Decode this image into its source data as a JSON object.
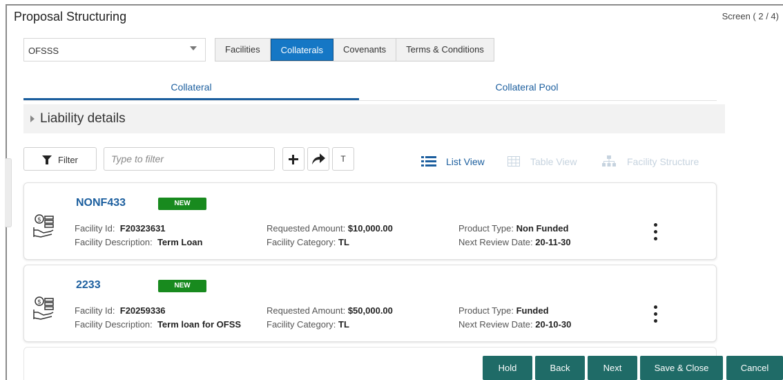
{
  "header": {
    "title": "Proposal Structuring",
    "screen_indicator": "Screen ( 2 / 4)"
  },
  "selector": {
    "value": "OFSSS"
  },
  "main_tabs": [
    {
      "label": "Facilities",
      "active": false
    },
    {
      "label": "Collaterals",
      "active": true
    },
    {
      "label": "Covenants",
      "active": false
    },
    {
      "label": "Terms & Conditions",
      "active": false
    }
  ],
  "sub_tabs": [
    {
      "label": "Collateral",
      "active": true
    },
    {
      "label": "Collateral Pool",
      "active": false
    }
  ],
  "section": {
    "liability_label": "Liability details"
  },
  "toolbar": {
    "filter_label": "Filter",
    "filter_placeholder": "Type to filter",
    "t_label": "T",
    "list_view": "List View",
    "table_view": "Table View",
    "facility_structure": "Facility Structure"
  },
  "cards": [
    {
      "title": "NONF433",
      "badge": "NEW",
      "facility_id_label": "Facility Id:",
      "facility_id": "F20323631",
      "facility_desc_label": "Facility Description:",
      "facility_desc": "Term Loan",
      "requested_amount_label": "Requested Amount:",
      "requested_amount": "$10,000.00",
      "facility_category_label": "Facility Category:",
      "facility_category": "TL",
      "product_type_label": "Product Type:",
      "product_type": "Non Funded",
      "next_review_label": "Next Review Date:",
      "next_review": "20-11-30"
    },
    {
      "title": "2233",
      "badge": "NEW",
      "facility_id_label": "Facility Id:",
      "facility_id": "F20259336",
      "facility_desc_label": "Facility Description:",
      "facility_desc": "Term loan for OFSS",
      "requested_amount_label": "Requested Amount:",
      "requested_amount": "$50,000.00",
      "facility_category_label": "Facility Category:",
      "facility_category": "TL",
      "product_type_label": "Product Type:",
      "product_type": "Funded",
      "next_review_label": "Next Review Date:",
      "next_review": "20-10-30"
    }
  ],
  "footer": {
    "hold": "Hold",
    "back": "Back",
    "next": "Next",
    "save_close": "Save & Close",
    "cancel": "Cancel"
  },
  "colors": {
    "primary": "#1577c5",
    "link": "#1b5e9e",
    "badge_green": "#188a1e",
    "footer_button": "#1f6b67"
  }
}
